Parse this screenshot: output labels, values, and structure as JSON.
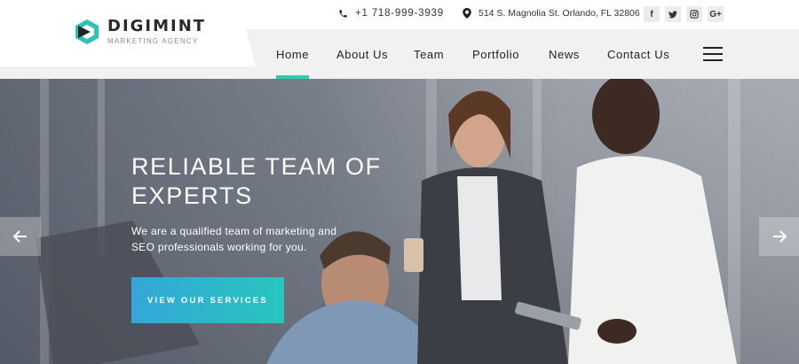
{
  "brand": {
    "name": "DIGIMINT",
    "tagline": "MARKETING AGENCY"
  },
  "topbar": {
    "phone": "+1 718-999-3939",
    "address": "514 S. Magnolia St. Orlando, FL 32806",
    "socials": [
      {
        "icon": "facebook-icon",
        "glyph": "f"
      },
      {
        "icon": "twitter-icon",
        "glyph": "t"
      },
      {
        "icon": "instagram-icon",
        "glyph": "◎"
      },
      {
        "icon": "google-plus-icon",
        "glyph": "G+"
      }
    ]
  },
  "nav": {
    "items": [
      {
        "label": "Home",
        "active": true
      },
      {
        "label": "About Us",
        "active": false
      },
      {
        "label": "Team",
        "active": false
      },
      {
        "label": "Portfolio",
        "active": false
      },
      {
        "label": "News",
        "active": false
      },
      {
        "label": "Contact Us",
        "active": false
      }
    ]
  },
  "hero": {
    "title": "RELIABLE TEAM OF EXPERTS",
    "description": "We are a qualified team of marketing and SEO professionals working for you.",
    "button": "VIEW OUR SERVICES"
  },
  "colors": {
    "accent": "#2dc9b0",
    "button_start": "#34a6d8",
    "button_end": "#27c6be",
    "text": "#222222"
  }
}
